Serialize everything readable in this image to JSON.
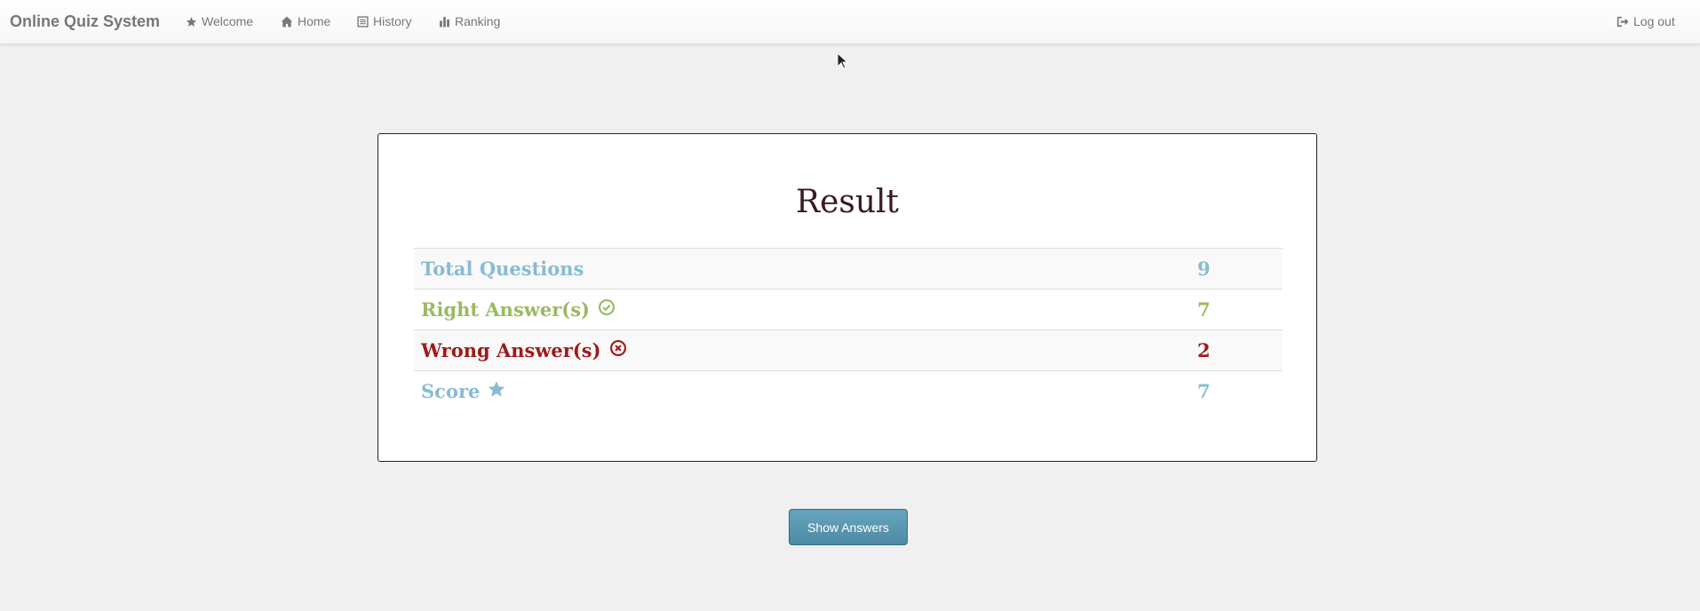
{
  "navbar": {
    "brand": "Online Quiz System",
    "links": [
      {
        "label": "Welcome",
        "icon": "star-icon"
      },
      {
        "label": "Home",
        "icon": "home-icon"
      },
      {
        "label": "History",
        "icon": "list-icon"
      },
      {
        "label": "Ranking",
        "icon": "bar-chart-icon"
      }
    ],
    "logout": {
      "label": "Log out",
      "icon": "logout-icon"
    }
  },
  "result": {
    "title": "Result",
    "rows": [
      {
        "label": "Total Questions",
        "value": "9",
        "color": "#88bcd2",
        "icon": null
      },
      {
        "label": "Right Answer(s)",
        "value": "7",
        "color": "#9aba61",
        "icon": "check-circle-icon"
      },
      {
        "label": "Wrong Answer(s)",
        "value": "2",
        "color": "#9e1b1b",
        "icon": "x-circle-icon"
      },
      {
        "label": "Score",
        "value": "7",
        "color": "#88bcd2",
        "icon": "star-icon"
      }
    ]
  },
  "actions": {
    "show_answers": "Show Answers"
  },
  "colors": {
    "page_bg": "#f0f0f0",
    "button": "#5a97b0",
    "title": "#3a1a24"
  }
}
